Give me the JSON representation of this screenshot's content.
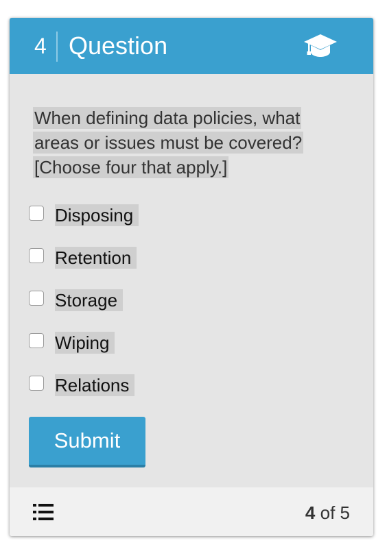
{
  "header": {
    "question_number": "4",
    "title": "Question",
    "icon": "graduation-cap-icon",
    "background_color": "#3aa0cf"
  },
  "question": {
    "prompt": "When defining data policies, what areas or issues must be covered? [Choose four that apply.]",
    "options": [
      {
        "label": "Disposing",
        "checked": false
      },
      {
        "label": "Retention",
        "checked": false
      },
      {
        "label": "Storage",
        "checked": false
      },
      {
        "label": "Wiping",
        "checked": false
      },
      {
        "label": "Relations",
        "checked": false
      }
    ]
  },
  "actions": {
    "submit_label": "Submit"
  },
  "footer": {
    "list_icon": "list-icon",
    "current": "4",
    "of_text": "of",
    "total": "5"
  }
}
